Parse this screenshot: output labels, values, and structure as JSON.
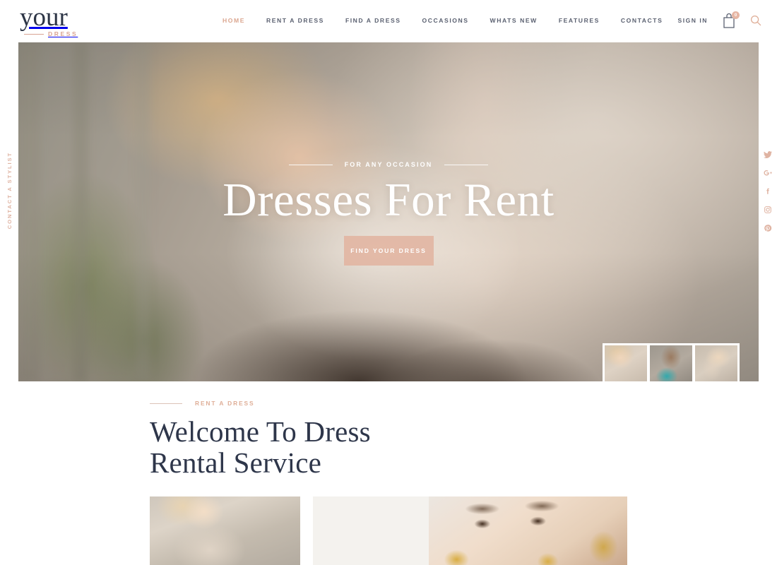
{
  "header": {
    "logo": {
      "word": "your",
      "sub": "DRESS"
    },
    "nav": [
      {
        "label": "HOME",
        "active": true
      },
      {
        "label": "RENT A DRESS",
        "active": false
      },
      {
        "label": "FIND A DRESS",
        "active": false
      },
      {
        "label": "OCCASIONS",
        "active": false
      },
      {
        "label": "WHATS NEW",
        "active": false
      },
      {
        "label": "FEATURES",
        "active": false
      },
      {
        "label": "CONTACTS",
        "active": false
      }
    ],
    "sign_in_label": "SIGN IN",
    "cart_icon": "shopping-bag-icon",
    "cart_count": "0",
    "search_icon": "search-icon"
  },
  "hero": {
    "eyebrow": "FOR ANY OCCASION",
    "title": "Dresses For Rent",
    "cta_label": "FIND YOUR DRESS",
    "thumbnails": [
      {
        "name": "thumbnail-1"
      },
      {
        "name": "thumbnail-2"
      },
      {
        "name": "thumbnail-3"
      }
    ]
  },
  "rails": {
    "left_label": "CONTACT A STYLIST",
    "social": [
      {
        "name": "twitter-icon",
        "glyph": "t"
      },
      {
        "name": "google-plus-icon",
        "glyph": "g"
      },
      {
        "name": "facebook-icon",
        "glyph": "f"
      },
      {
        "name": "instagram-icon",
        "glyph": "i"
      },
      {
        "name": "pinterest-icon",
        "glyph": "p"
      }
    ]
  },
  "welcome": {
    "eyebrow": "RENT A DRESS",
    "title_line1": "Welcome To Dress",
    "title_line2": "Rental Service"
  },
  "gallery": {
    "left_image": "model-in-ruffled-dress",
    "panel": "cream-panel",
    "right_image": "closeup-face-with-gold-nails"
  },
  "colors": {
    "accent_pink": "#dfae97",
    "button_pink": "#e1b4a1",
    "navy": "#2e364a",
    "nav_grey": "#5a6070",
    "panel_cream": "#f4f2ee"
  }
}
